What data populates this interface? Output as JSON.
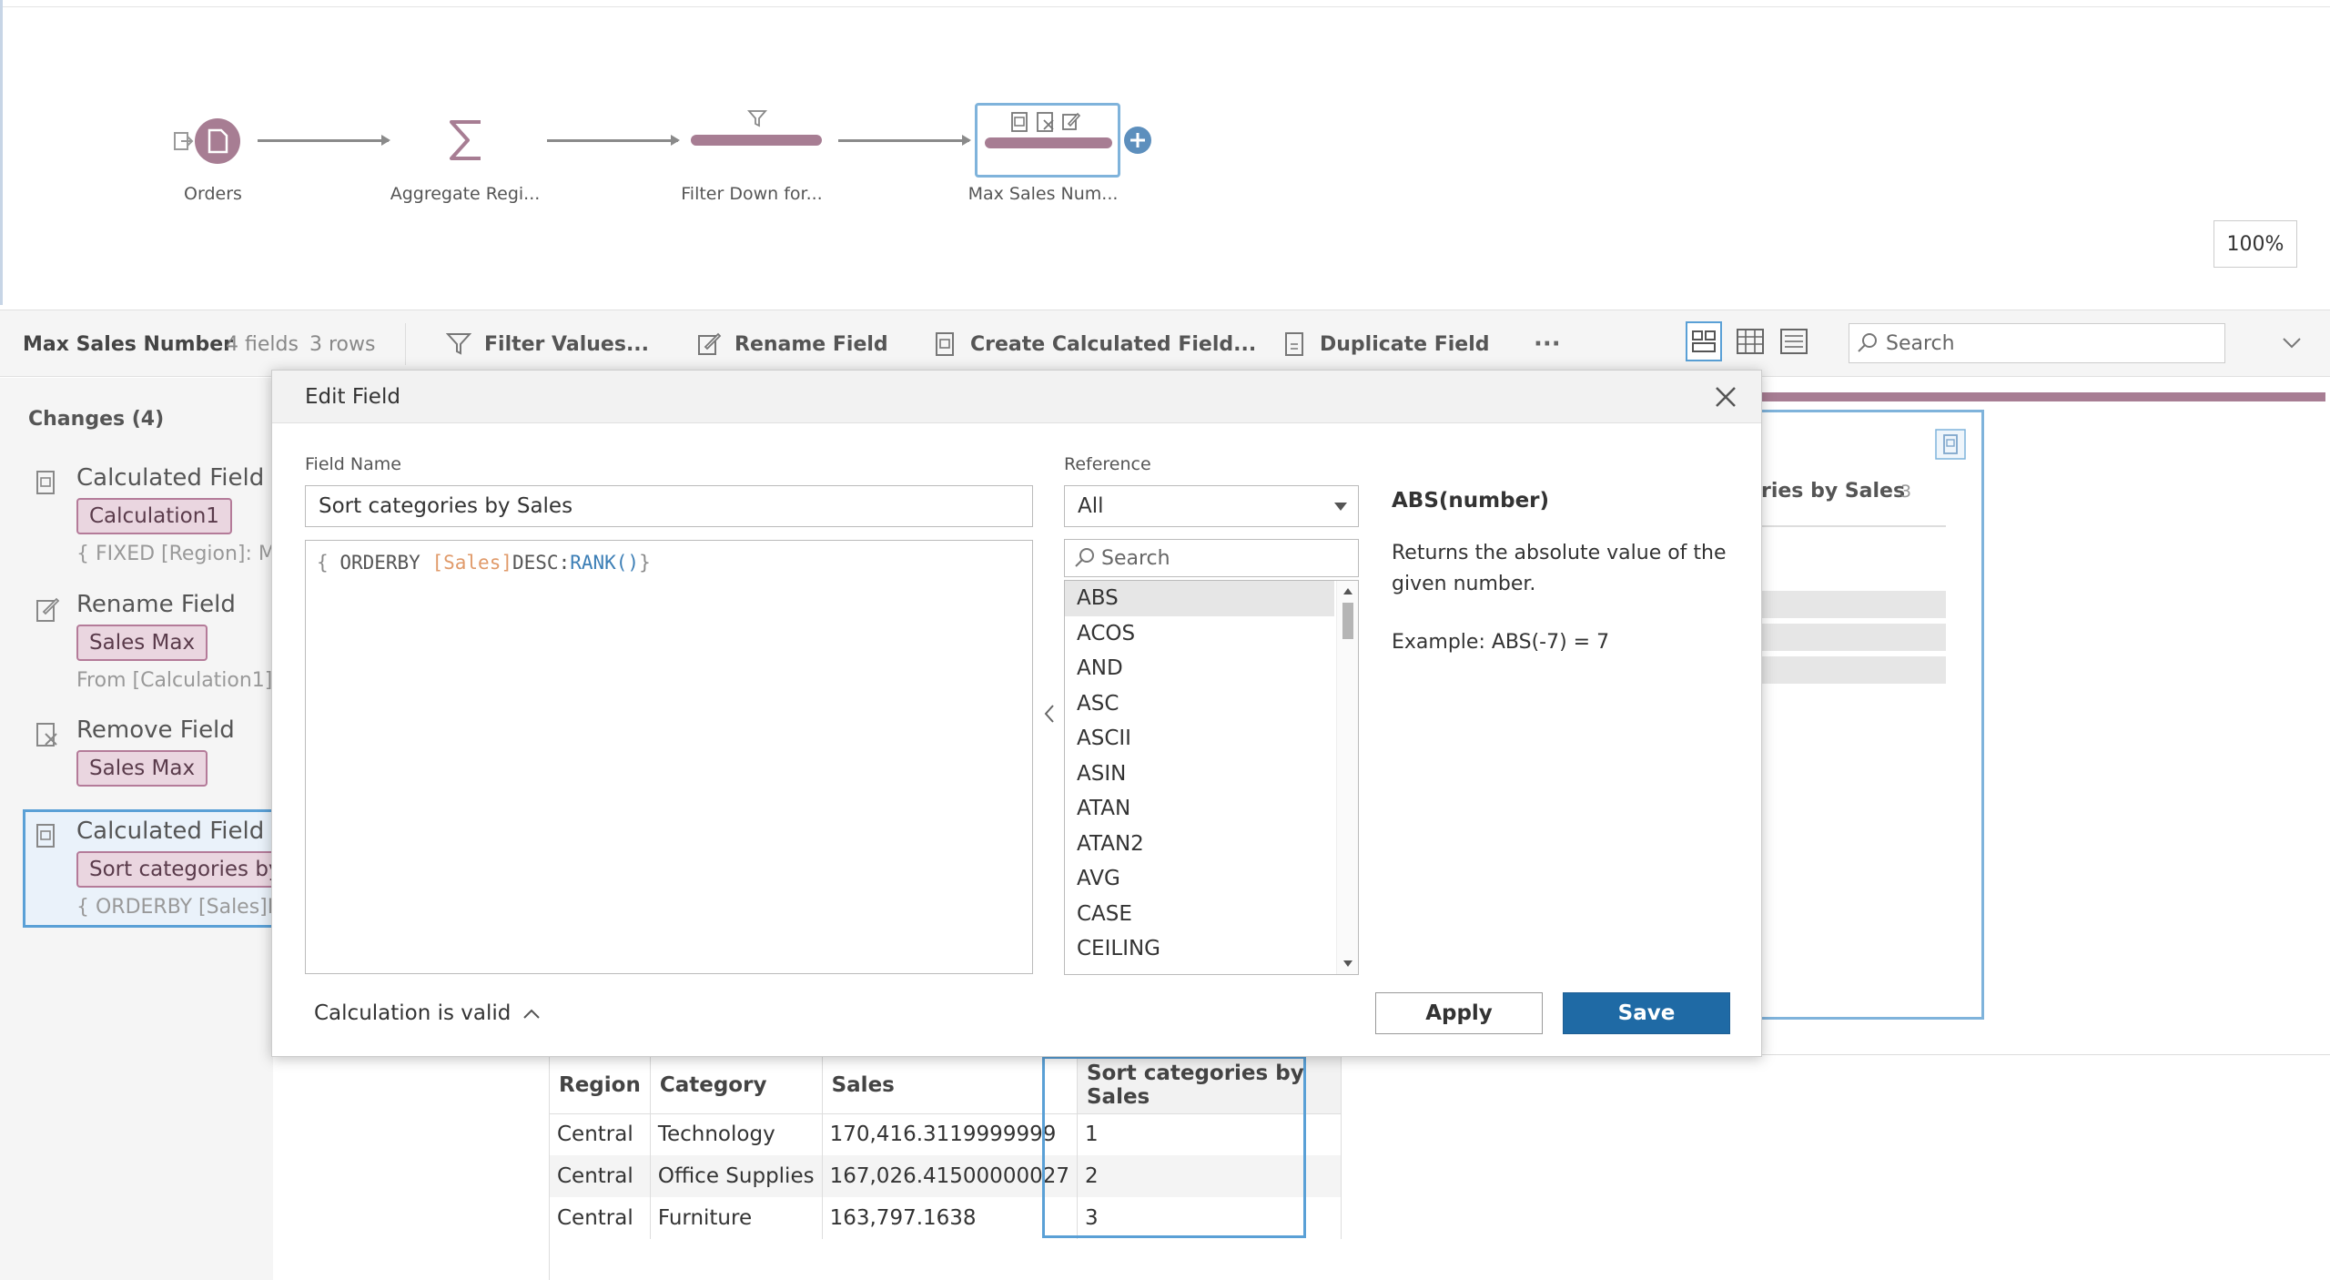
{
  "flow": {
    "nodes": [
      {
        "label": "Orders"
      },
      {
        "label": "Aggregate Regi..."
      },
      {
        "label": "Filter Down for..."
      },
      {
        "label": "Max Sales Num..."
      }
    ],
    "zoom": "100%"
  },
  "toolbar": {
    "step_name": "Max Sales Number",
    "fields": "4 fields",
    "rows": "3 rows",
    "filter": "Filter Values...",
    "rename": "Rename Field",
    "create_calc": "Create Calculated Field...",
    "duplicate": "Duplicate Field",
    "more": "···",
    "search_placeholder": "Search"
  },
  "changes": {
    "title": "Changes (4)",
    "items": [
      {
        "head": "Calculated Field",
        "pill": "Calculation1",
        "sub": "{ FIXED [Region]: M..."
      },
      {
        "head": "Rename Field",
        "pill": "Sales Max",
        "sub": "From [Calculation1]"
      },
      {
        "head": "Remove Field",
        "pill": "Sales Max",
        "sub": ""
      },
      {
        "head": "Calculated Field",
        "pill": "Sort categories by",
        "sub": "{ ORDERBY [Sales]D"
      }
    ]
  },
  "profile": {
    "card_title": "ries by Sales",
    "card_count": "3"
  },
  "dialog": {
    "title": "Edit Field",
    "field_name_label": "Field Name",
    "field_name_value": "Sort categories by Sales",
    "code": {
      "open": "{",
      "kw": "ORDERBY",
      "field": "[Sales]",
      "desc": "DESC:",
      "fn": "RANK()",
      "close": "}"
    },
    "reference_label": "Reference",
    "reference_value": "All",
    "ref_search_placeholder": "Search",
    "ref_items": [
      "ABS",
      "ACOS",
      "AND",
      "ASC",
      "ASCII",
      "ASIN",
      "ATAN",
      "ATAN2",
      "AVG",
      "CASE",
      "CEILING"
    ],
    "help_title": "ABS(number)",
    "help_body": "Returns the absolute value of the given number.",
    "help_example": "Example: ABS(-7) = 7",
    "status": "Calculation is valid",
    "apply": "Apply",
    "save": "Save"
  },
  "grid": {
    "headers": [
      "Region",
      "Category",
      "Sales",
      "Sort categories by Sales"
    ],
    "rows": [
      [
        "Central",
        "Technology",
        "170,416.3119999999",
        "1"
      ],
      [
        "Central",
        "Office Supplies",
        "167,026.41500000027",
        "2"
      ],
      [
        "Central",
        "Furniture",
        "163,797.1638",
        "3"
      ]
    ]
  },
  "colors": {
    "accent": "#1f6aa5",
    "pill": "#ead6e0",
    "pill_border": "#b47b99",
    "selection": "#5aa0d6",
    "node": "#a77d93"
  }
}
